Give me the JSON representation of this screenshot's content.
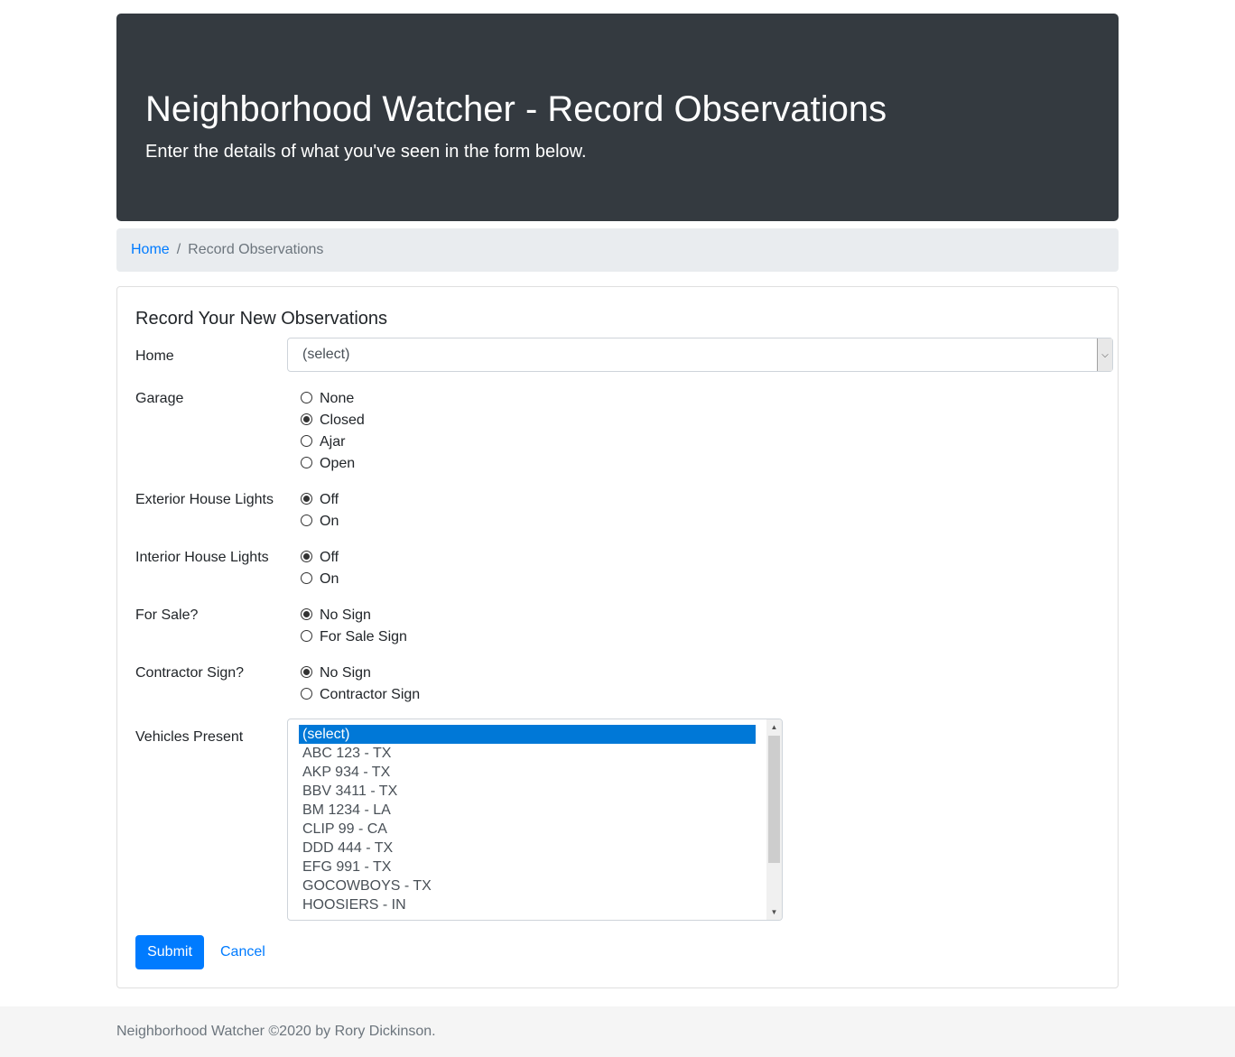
{
  "header": {
    "title": "Neighborhood Watcher - Record Observations",
    "subtitle": "Enter the details of what you've seen in the form below."
  },
  "breadcrumb": {
    "home": "Home",
    "separator": "/",
    "current": "Record Observations"
  },
  "form": {
    "title": "Record Your New Observations",
    "home": {
      "label": "Home",
      "value": "(select)"
    },
    "garage": {
      "label": "Garage",
      "options": [
        "None",
        "Closed",
        "Ajar",
        "Open"
      ],
      "selected": "Closed"
    },
    "exterior_lights": {
      "label": "Exterior House Lights",
      "options": [
        "Off",
        "On"
      ],
      "selected": "Off"
    },
    "interior_lights": {
      "label": "Interior House Lights",
      "options": [
        "Off",
        "On"
      ],
      "selected": "Off"
    },
    "for_sale": {
      "label": "For Sale?",
      "options": [
        "No Sign",
        "For Sale Sign"
      ],
      "selected": "No Sign"
    },
    "contractor": {
      "label": "Contractor Sign?",
      "options": [
        "No Sign",
        "Contractor Sign"
      ],
      "selected": "No Sign"
    },
    "vehicles": {
      "label": "Vehicles Present",
      "options": [
        "(select)",
        "ABC 123 - TX",
        "AKP 934 - TX",
        "BBV 3411 - TX",
        "BM 1234 - LA",
        "CLIP 99 - CA",
        "DDD 444 - TX",
        "EFG 991 - TX",
        "GOCOWBOYS - TX",
        "HOOSIERS - IN"
      ],
      "selected": "(select)"
    },
    "submit_label": "Submit",
    "cancel_label": "Cancel"
  },
  "footer": {
    "text": "Neighborhood Watcher ©2020 by Rory Dickinson."
  },
  "colors": {
    "jumbotron_bg": "#343a40",
    "primary": "#007bff",
    "selection": "#0078d7"
  }
}
